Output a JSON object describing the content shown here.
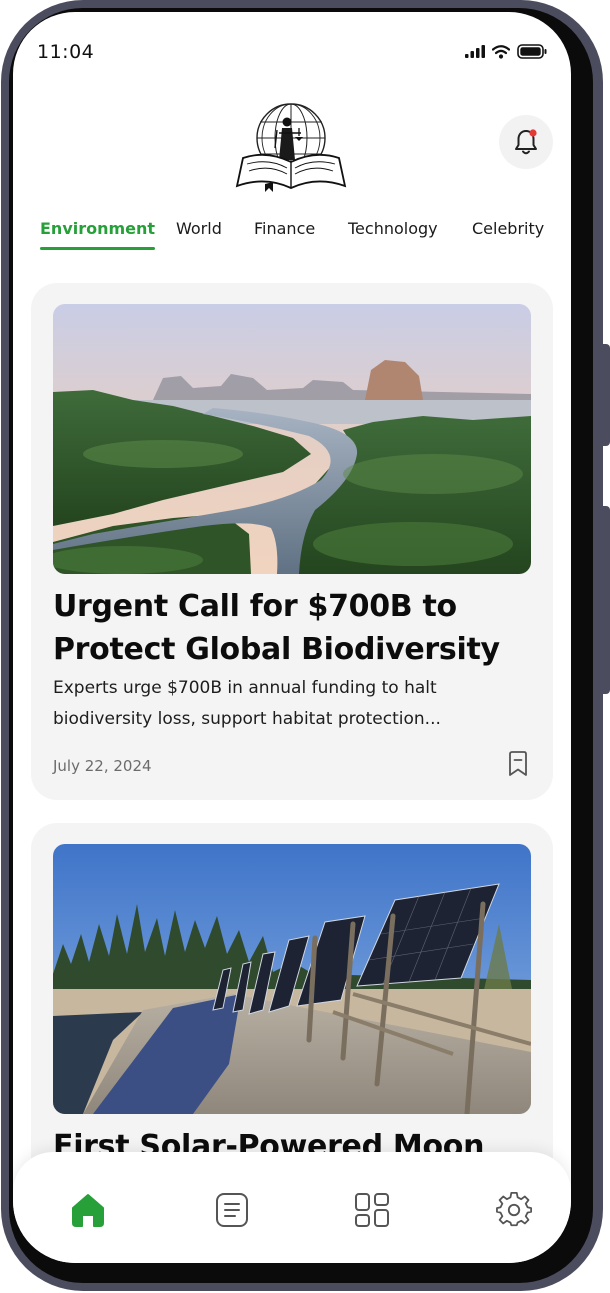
{
  "status_bar": {
    "time": "11:04"
  },
  "tabs": [
    {
      "label": "Environment",
      "active": true
    },
    {
      "label": "World"
    },
    {
      "label": "Finance"
    },
    {
      "label": "Technology"
    },
    {
      "label": "Celebrity"
    }
  ],
  "articles": [
    {
      "title": "Urgent Call for $700B to Protect Global Biodiversity",
      "description": "Experts urge $700B in annual funding to halt biodiversity loss, support habitat protection...",
      "date": "July 22, 2024",
      "image": "aerial-river-mangrove-forest"
    },
    {
      "title": "First Solar-Powered Moon",
      "image": "solar-panels-on-boardwalk"
    }
  ],
  "bottom_nav": [
    {
      "icon": "home-icon",
      "active": true
    },
    {
      "icon": "articles-icon"
    },
    {
      "icon": "categories-icon"
    },
    {
      "icon": "settings-icon"
    }
  ],
  "colors": {
    "accent": "#28a03a",
    "card_bg": "#f4f4f4",
    "device_frame": "#4b4c5e"
  }
}
